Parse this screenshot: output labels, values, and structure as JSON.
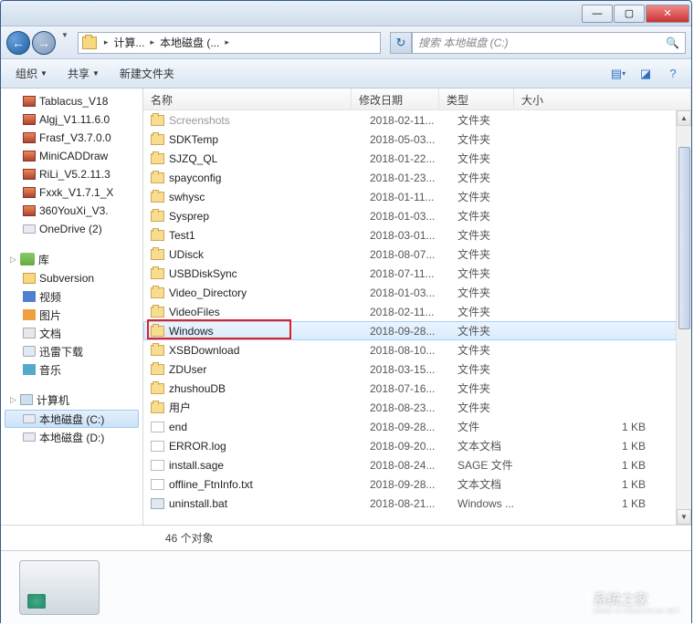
{
  "titlebar": {
    "min": "—",
    "max": "▢",
    "close": "✕"
  },
  "nav": {
    "back": "←",
    "fwd": "→",
    "refresh": "↻"
  },
  "breadcrumb": {
    "seg1": "计算...",
    "seg2": "本地磁盘 (...",
    "search_placeholder": "搜索 本地磁盘 (C:)"
  },
  "toolbar": {
    "organize": "组织",
    "share": "共享",
    "newfolder": "新建文件夹"
  },
  "sidebar": {
    "items": [
      {
        "label": "Tablacus_V18"
      },
      {
        "label": "Algj_V1.11.6.0"
      },
      {
        "label": "Frasf_V3.7.0.0"
      },
      {
        "label": "MiniCADDraw"
      },
      {
        "label": "RiLi_V5.2.11.3"
      },
      {
        "label": "Fxxk_V1.7.1_X"
      },
      {
        "label": "360YouXi_V3."
      },
      {
        "label": "OneDrive (2)"
      }
    ],
    "lib_header": "库",
    "libs": [
      {
        "label": "Subversion"
      },
      {
        "label": "视频"
      },
      {
        "label": "图片"
      },
      {
        "label": "文档"
      },
      {
        "label": "迅雷下载"
      },
      {
        "label": "音乐"
      }
    ],
    "comp_header": "计算机",
    "drives": [
      {
        "label": "本地磁盘 (C:)"
      },
      {
        "label": "本地磁盘 (D:)"
      }
    ]
  },
  "columns": {
    "name": "名称",
    "date": "修改日期",
    "type": "类型",
    "size": "大小"
  },
  "rows": [
    {
      "name": "Screenshots",
      "date": "2018-02-11...",
      "type": "文件夹",
      "size": "",
      "icon": "folder",
      "faded": true
    },
    {
      "name": "SDKTemp",
      "date": "2018-05-03...",
      "type": "文件夹",
      "size": "",
      "icon": "folder"
    },
    {
      "name": "SJZQ_QL",
      "date": "2018-01-22...",
      "type": "文件夹",
      "size": "",
      "icon": "folder"
    },
    {
      "name": "spayconfig",
      "date": "2018-01-23...",
      "type": "文件夹",
      "size": "",
      "icon": "folder"
    },
    {
      "name": "swhysc",
      "date": "2018-01-11...",
      "type": "文件夹",
      "size": "",
      "icon": "folder"
    },
    {
      "name": "Sysprep",
      "date": "2018-01-03...",
      "type": "文件夹",
      "size": "",
      "icon": "folder"
    },
    {
      "name": "Test1",
      "date": "2018-03-01...",
      "type": "文件夹",
      "size": "",
      "icon": "folder"
    },
    {
      "name": "UDisck",
      "date": "2018-08-07...",
      "type": "文件夹",
      "size": "",
      "icon": "folder"
    },
    {
      "name": "USBDiskSync",
      "date": "2018-07-11...",
      "type": "文件夹",
      "size": "",
      "icon": "folder"
    },
    {
      "name": "Video_Directory",
      "date": "2018-01-03...",
      "type": "文件夹",
      "size": "",
      "icon": "folder"
    },
    {
      "name": "VideoFiles",
      "date": "2018-02-11...",
      "type": "文件夹",
      "size": "",
      "icon": "folder"
    },
    {
      "name": "Windows",
      "date": "2018-09-28...",
      "type": "文件夹",
      "size": "",
      "icon": "folder",
      "selected": true,
      "boxed": true
    },
    {
      "name": "XSBDownload",
      "date": "2018-08-10...",
      "type": "文件夹",
      "size": "",
      "icon": "folder"
    },
    {
      "name": "ZDUser",
      "date": "2018-03-15...",
      "type": "文件夹",
      "size": "",
      "icon": "folder"
    },
    {
      "name": "zhushouDB",
      "date": "2018-07-16...",
      "type": "文件夹",
      "size": "",
      "icon": "folder"
    },
    {
      "name": "用户",
      "date": "2018-08-23...",
      "type": "文件夹",
      "size": "",
      "icon": "folder"
    },
    {
      "name": "end",
      "date": "2018-09-28...",
      "type": "文件",
      "size": "1 KB",
      "icon": "file"
    },
    {
      "name": "ERROR.log",
      "date": "2018-09-20...",
      "type": "文本文档",
      "size": "1 KB",
      "icon": "txt"
    },
    {
      "name": "install.sage",
      "date": "2018-08-24...",
      "type": "SAGE 文件",
      "size": "1 KB",
      "icon": "file"
    },
    {
      "name": "offline_FtnInfo.txt",
      "date": "2018-09-28...",
      "type": "文本文档",
      "size": "1 KB",
      "icon": "txt"
    },
    {
      "name": "uninstall.bat",
      "date": "2018-08-21...",
      "type": "Windows ...",
      "size": "1 KB",
      "icon": "bat"
    }
  ],
  "status": {
    "count": "46 个对象"
  },
  "watermark": {
    "text": "系统之家",
    "sub": "WWW.XITONGZHIJIA.NET"
  }
}
